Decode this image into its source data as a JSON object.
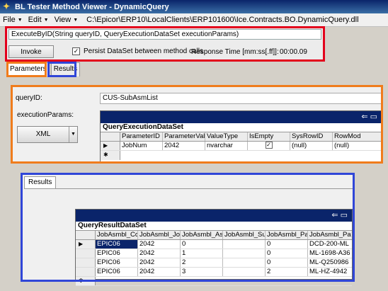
{
  "window": {
    "title": "BL Tester Method Viewer - DynamicQuery"
  },
  "menu": {
    "file": "File",
    "edit": "Edit",
    "view": "View",
    "path": "C:\\Epicor\\ERP10\\LocalClients\\ERP101600\\Ice.Contracts.BO.DynamicQuery.dll"
  },
  "method": {
    "signature": "ExecuteByID(String  queryID,  QueryExecutionDataSet  executionParams)",
    "invoke_label": "Invoke",
    "persist_label": "Persist DataSet between method calls",
    "persist_checked": true,
    "response_label": "Response Time [mm:ss[.ff]]:",
    "response_value": "00:00.09"
  },
  "tabs": [
    "Parameters",
    "Results"
  ],
  "params": {
    "queryid_label": "queryID:",
    "queryid_value": "CUS-SubAsmList",
    "exec_label": "executionParams:",
    "xml_label": "XML"
  },
  "exec_grid": {
    "caption": "QueryExecutionDataSet",
    "columns": [
      "ParameterID",
      "ParameterVal",
      "ValueType",
      "IsEmpty",
      "SysRowID",
      "RowMod"
    ],
    "rows": [
      [
        "JobNum",
        "2042",
        "nvarchar",
        "",
        "(null)",
        "(null)"
      ]
    ]
  },
  "results": {
    "tab_label": "Results",
    "caption": "QueryResultDataSet",
    "columns": [
      "JobAsmbl_Co",
      "JobAsmbl_Jo",
      "JobAsmbl_As",
      "JobAsmbl_Su",
      "JobAsmbl_Pa",
      "JobAsmbl_Pa"
    ],
    "rows": [
      [
        "EPIC06",
        "2042",
        "0",
        "",
        "0",
        "DCD-200-ML"
      ],
      [
        "EPIC06",
        "2042",
        "1",
        "",
        "0",
        "ML-1698-A36"
      ],
      [
        "EPIC06",
        "2042",
        "2",
        "",
        "0",
        "ML-Q250986"
      ],
      [
        "EPIC06",
        "2042",
        "3",
        "",
        "2",
        "ML-HZ-4942"
      ]
    ]
  },
  "colors": {
    "highlight_red": "#e3001b",
    "highlight_orange": "#f07c1c",
    "highlight_blue": "#3046d8",
    "grid_header": "#0a246a"
  }
}
